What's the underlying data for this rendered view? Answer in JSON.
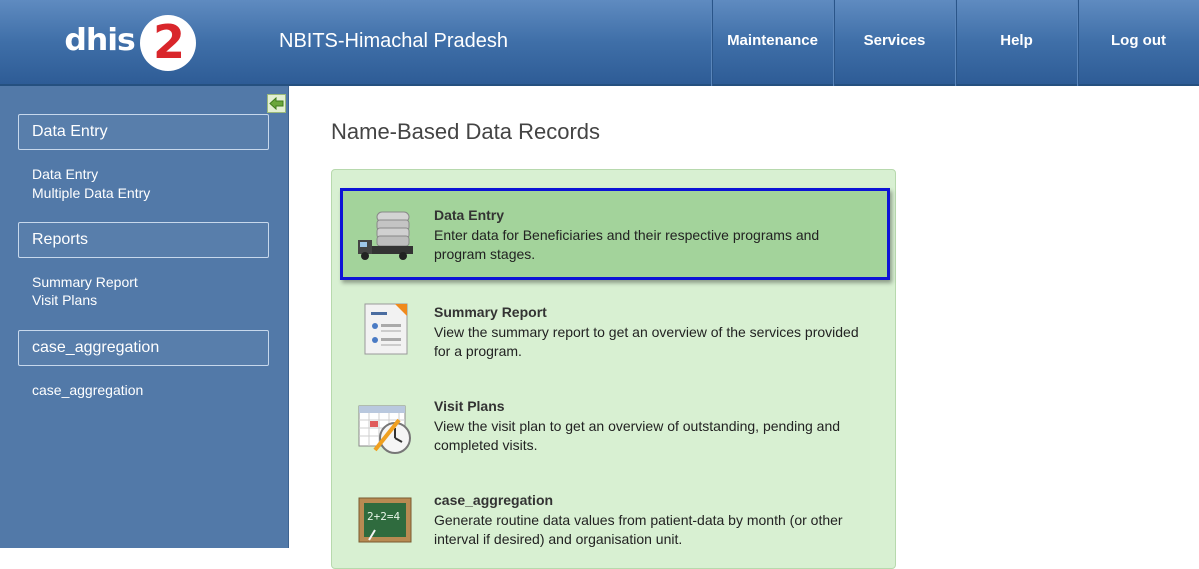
{
  "header": {
    "logo_text": "dhis",
    "logo_number": "2",
    "app_title": "NBITS-Himachal Pradesh",
    "nav": [
      {
        "label": "Maintenance"
      },
      {
        "label": "Services"
      },
      {
        "label": "Help"
      },
      {
        "label": "Log out"
      }
    ]
  },
  "sidebar": {
    "groups": [
      {
        "label": "Data Entry",
        "links": [
          "Data Entry",
          "Multiple Data Entry"
        ]
      },
      {
        "label": "Reports",
        "links": [
          "Summary Report",
          "Visit Plans"
        ]
      },
      {
        "label": "case_aggregation",
        "links": [
          "case_aggregation"
        ]
      }
    ],
    "collapse_icon": "arrow-left-icon"
  },
  "main": {
    "title": "Name-Based Data Records",
    "items": [
      {
        "title": "Data Entry",
        "desc": "Enter data for Beneficiaries and their respective programs and program stages.",
        "icon": "truck-database-icon",
        "selected": true
      },
      {
        "title": "Summary Report",
        "desc": "View the summary report to get an overview of the services provided for a program.",
        "icon": "report-document-icon",
        "selected": false
      },
      {
        "title": "Visit Plans",
        "desc": "View the visit plan to get an overview of outstanding, pending and completed visits.",
        "icon": "calendar-clock-icon",
        "selected": false
      },
      {
        "title": "case_aggregation",
        "desc": "Generate routine data values from patient-data by month (or other interval if desired) and organisation unit.",
        "icon": "chalkboard-icon",
        "selected": false
      }
    ]
  },
  "colors": {
    "header": "#3f6fa8",
    "sidebar": "#5279a8",
    "panel": "#d8f0d2",
    "selected_item": "#a3d39b",
    "selection_border": "#0d13d6",
    "logo_red": "#d9262b"
  }
}
